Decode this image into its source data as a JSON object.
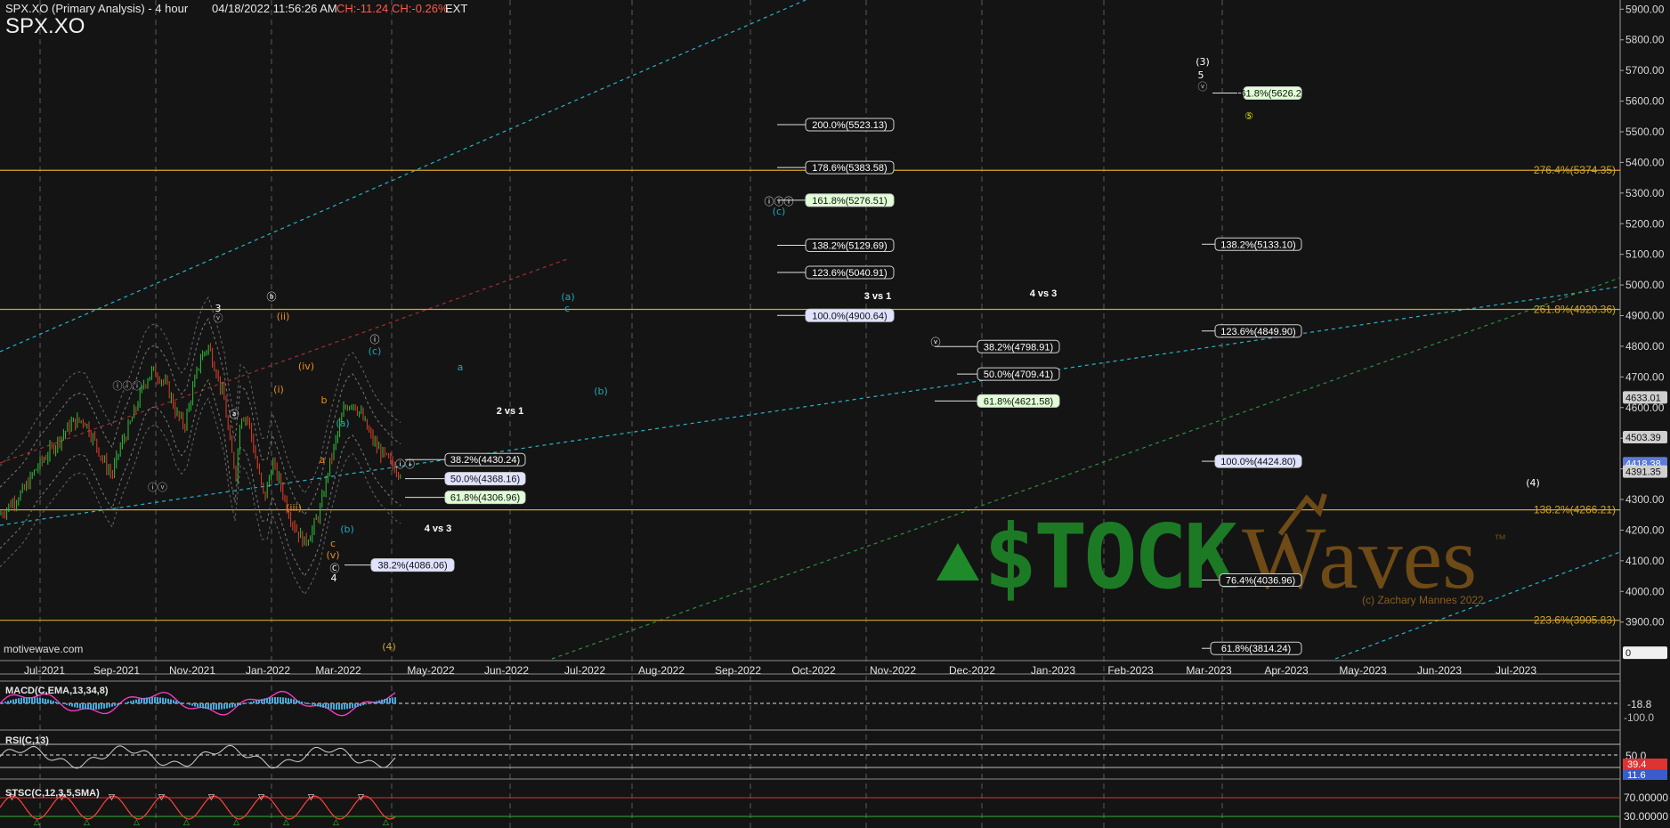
{
  "header": {
    "title": "SPX.XO (Primary Analysis) - 4 hour",
    "datetime": "04/18/2022 11:56:26 AM",
    "change": "CH:-11.24",
    "change_pct": "CH:-0.26%",
    "session": "EXT",
    "symbol": "SPX.XO",
    "source": "motivewave.com"
  },
  "colors": {
    "background": "#141414",
    "fib_line": "#d4a62a",
    "channel_cyan": "#28b4c8",
    "channel_green": "#2e8b3e",
    "up_bar": "#2fbf3a",
    "down_bar": "#e0402a",
    "macd_line": "#ff3bd0",
    "rsi_line": "#cfcfcf",
    "stoch_line": "#ff4040",
    "oversold_marker": "#3cd23c",
    "overbought_marker": "#ffffff"
  },
  "watermark": {
    "brand_a": "$TOCK",
    "brand_b": "Waves",
    "tm": "™",
    "credit": "(c) Zachary Mannes 2022"
  },
  "chart_data": {
    "type": "candlestick",
    "symbol": "SPX.XO",
    "timeframe": "4 hour",
    "x_axis": {
      "ticks": [
        "Jul-2021",
        "Sep-2021",
        "Nov-2021",
        "Jan-2022",
        "Mar-2022",
        "May-2022",
        "Jun-2022",
        "Jul-2022",
        "Aug-2022",
        "Sep-2022",
        "Oct-2022",
        "Nov-2022",
        "Dec-2022",
        "Jan-2023",
        "Feb-2023",
        "Mar-2023",
        "Apr-2023",
        "May-2023",
        "Jun-2023",
        "Jul-2023"
      ]
    },
    "y_axis": {
      "ticks": [
        3900,
        4000,
        4100,
        4200,
        4300,
        4400,
        4500,
        4600,
        4700,
        4800,
        4900,
        5000,
        5100,
        5200,
        5300,
        5400,
        5500,
        5600,
        5700,
        5800,
        5900
      ],
      "range": [
        3780,
        5930
      ],
      "price_flags": [
        {
          "label": "4633.01",
          "value": 4633.01,
          "bg": "#cfcfcf",
          "fg": "#111"
        },
        {
          "label": "4503.39",
          "value": 4503.39,
          "bg": "#cfcfcf",
          "fg": "#111"
        },
        {
          "label": "4418.38",
          "value": 4418.38,
          "bg": "#5b7bd6",
          "fg": "#fff"
        },
        {
          "label": "4391.35",
          "value": 4391.35,
          "bg": "#cfcfcf",
          "fg": "#111"
        },
        {
          "label": "0",
          "value": 3800,
          "bg": "#f0f0f0",
          "fg": "#111"
        }
      ]
    },
    "price_path": [
      [
        0,
        4250
      ],
      [
        0.03,
        4290
      ],
      [
        0.06,
        4330
      ],
      [
        0.09,
        4400
      ],
      [
        0.12,
        4450
      ],
      [
        0.15,
        4500
      ],
      [
        0.18,
        4550
      ],
      [
        0.21,
        4560
      ],
      [
        0.24,
        4480
      ],
      [
        0.26,
        4420
      ],
      [
        0.28,
        4380
      ],
      [
        0.3,
        4470
      ],
      [
        0.32,
        4530
      ],
      [
        0.34,
        4600
      ],
      [
        0.36,
        4680
      ],
      [
        0.38,
        4720
      ],
      [
        0.4,
        4700
      ],
      [
        0.42,
        4660
      ],
      [
        0.44,
        4580
      ],
      [
        0.46,
        4540
      ],
      [
        0.48,
        4650
      ],
      [
        0.5,
        4760
      ],
      [
        0.52,
        4800
      ],
      [
        0.54,
        4720
      ],
      [
        0.56,
        4620
      ],
      [
        0.575,
        4470
      ],
      [
        0.59,
        4380
      ],
      [
        0.6,
        4580
      ],
      [
        0.62,
        4560
      ],
      [
        0.64,
        4420
      ],
      [
        0.66,
        4300
      ],
      [
        0.68,
        4420
      ],
      [
        0.7,
        4350
      ],
      [
        0.72,
        4260
      ],
      [
        0.74,
        4200
      ],
      [
        0.76,
        4160
      ],
      [
        0.78,
        4200
      ],
      [
        0.8,
        4270
      ],
      [
        0.82,
        4400
      ],
      [
        0.84,
        4500
      ],
      [
        0.86,
        4600
      ],
      [
        0.88,
        4620
      ],
      [
        0.9,
        4580
      ],
      [
        0.92,
        4520
      ],
      [
        0.94,
        4470
      ],
      [
        0.96,
        4440
      ],
      [
        0.98,
        4410
      ],
      [
        1.0,
        4391
      ]
    ],
    "fib_horizontal": [
      {
        "label": "276.4%(5374.35)",
        "value": 5374.35
      },
      {
        "label": "261.8%(4920.36)",
        "value": 4920.36
      },
      {
        "label": "138.2%(4266.21)",
        "value": 4266.21
      },
      {
        "label": "223.6%(3905.83)",
        "value": 3905.83
      }
    ],
    "fib_boxes": [
      {
        "group": "2 vs 1",
        "label": "38.2%(4430.24)",
        "value": 4430.24,
        "style": "dark"
      },
      {
        "group": "2 vs 1",
        "label": "50.0%(4368.16)",
        "value": 4368.16,
        "style": "blue"
      },
      {
        "group": "2 vs 1",
        "label": "61.8%(4306.96)",
        "value": 4306.96,
        "style": "green"
      },
      {
        "group": "4 vs 3",
        "label": "38.2%(4086.06)",
        "value": 4086.06,
        "style": "blue"
      },
      {
        "group": "3 vs 1",
        "label": "200.0%(5523.13)",
        "value": 5523.13,
        "style": "dark"
      },
      {
        "group": "3 vs 1",
        "label": "178.6%(5383.58)",
        "value": 5383.58,
        "style": "dark"
      },
      {
        "group": "3 vs 1",
        "label": "161.8%(5276.51)",
        "value": 5276.51,
        "style": "green"
      },
      {
        "group": "3 vs 1",
        "label": "138.2%(5129.69)",
        "value": 5129.69,
        "style": "dark"
      },
      {
        "group": "3 vs 1",
        "label": "123.6%(5040.91)",
        "value": 5040.91,
        "style": "dark"
      },
      {
        "group": "3 vs 1",
        "label": "100.0%(4900.64)",
        "value": 4900.64,
        "style": "blue"
      },
      {
        "group": "4 vs 3",
        "label": "38.2%(4798.91)",
        "value": 4798.91,
        "style": "dark"
      },
      {
        "group": "4 vs 3",
        "label": "50.0%(4709.41)",
        "value": 4709.41,
        "style": "dark"
      },
      {
        "group": "4 vs 3",
        "label": "61.8%(4621.58)",
        "value": 4621.58,
        "style": "green"
      },
      {
        "group": "5",
        "label": "161.8%(5626.25)",
        "value": 5626.25,
        "style": "green"
      },
      {
        "group": "5",
        "label": "138.2%(5133.10)",
        "value": 5133.1,
        "style": "dark"
      },
      {
        "group": "5",
        "label": "123.6%(4849.90)",
        "value": 4849.9,
        "style": "dark"
      },
      {
        "group": "5",
        "label": "100.0%(4424.80)",
        "value": 4424.8,
        "style": "blue"
      },
      {
        "group": "5",
        "label": "76.4%(4036.96)",
        "value": 4036.96,
        "style": "dark"
      },
      {
        "group": "5",
        "label": "61.8%(3814.24)",
        "value": 3814.24,
        "style": "dark"
      }
    ],
    "group_labels": [
      "2 vs 1",
      "4 vs 3",
      "3 vs 1",
      "4 vs 3"
    ],
    "wave_labels": [
      {
        "text": "3",
        "color": "#ffffff"
      },
      {
        "text": "ⓥ",
        "color": "#bbbbbb"
      },
      {
        "text": "ⓑ",
        "color": "#ffffff"
      },
      {
        "text": "(ii)",
        "color": "#e8901e"
      },
      {
        "text": "ⓘⓘⓘ",
        "color": "#bbbbbb"
      },
      {
        "text": "ⓐ",
        "color": "#ffffff"
      },
      {
        "text": "(i)",
        "color": "#e8901e"
      },
      {
        "text": "(iv)",
        "color": "#e8901e"
      },
      {
        "text": "b",
        "color": "#e8901e"
      },
      {
        "text": "ⓘⓥ",
        "color": "#bbbbbb"
      },
      {
        "text": "(iii)",
        "color": "#e8901e"
      },
      {
        "text": "a",
        "color": "#e8901e"
      },
      {
        "text": "(a)",
        "color": "#1ba9b9"
      },
      {
        "text": "(b)",
        "color": "#1ba9b9"
      },
      {
        "text": "c",
        "color": "#e8901e"
      },
      {
        "text": "(v)",
        "color": "#e8901e"
      },
      {
        "text": "Ⓒ",
        "color": "#ffffff"
      },
      {
        "text": "4",
        "color": "#ffffff"
      },
      {
        "text": "ⓘ",
        "color": "#ffffff"
      },
      {
        "text": "(c)",
        "color": "#1ba9b9"
      },
      {
        "text": "ⓘⓘ",
        "color": "#ffffff"
      },
      {
        "text": "a",
        "color": "#1ba9b9"
      },
      {
        "text": "(a)",
        "color": "#1ba9b9"
      },
      {
        "text": "c",
        "color": "#1ba9b9"
      },
      {
        "text": "(b)",
        "color": "#1ba9b9"
      },
      {
        "text": "ⓘⓘⓘ",
        "color": "#ffffff"
      },
      {
        "text": "(c)",
        "color": "#1ba9b9"
      },
      {
        "text": "ⓥ",
        "color": "#ffffff"
      },
      {
        "text": "(3)",
        "color": "#ffffff"
      },
      {
        "text": "5",
        "color": "#ffffff"
      },
      {
        "text": "ⓥ",
        "color": "#bbbbbb"
      },
      {
        "text": "⑤",
        "color": "#e6e600"
      },
      {
        "text": "(4)",
        "color": "#d4a62a"
      },
      {
        "text": "(4)",
        "color": "#ffffff"
      }
    ],
    "indicators": {
      "macd": {
        "title": "MACD(C,EMA,13,34,8)",
        "flags": [
          "-18.8",
          "-100.0"
        ],
        "range": [
          -200,
          200
        ]
      },
      "rsi": {
        "title": "RSI(C,13)",
        "flags": [
          "50.0",
          "39.4",
          "11.6"
        ],
        "range": [
          0,
          100
        ]
      },
      "stoch": {
        "title": "STSC(C,12,3,5,SMA)",
        "flags": [
          "70.00000",
          "30.00000"
        ],
        "range": [
          0,
          100
        ]
      }
    }
  }
}
